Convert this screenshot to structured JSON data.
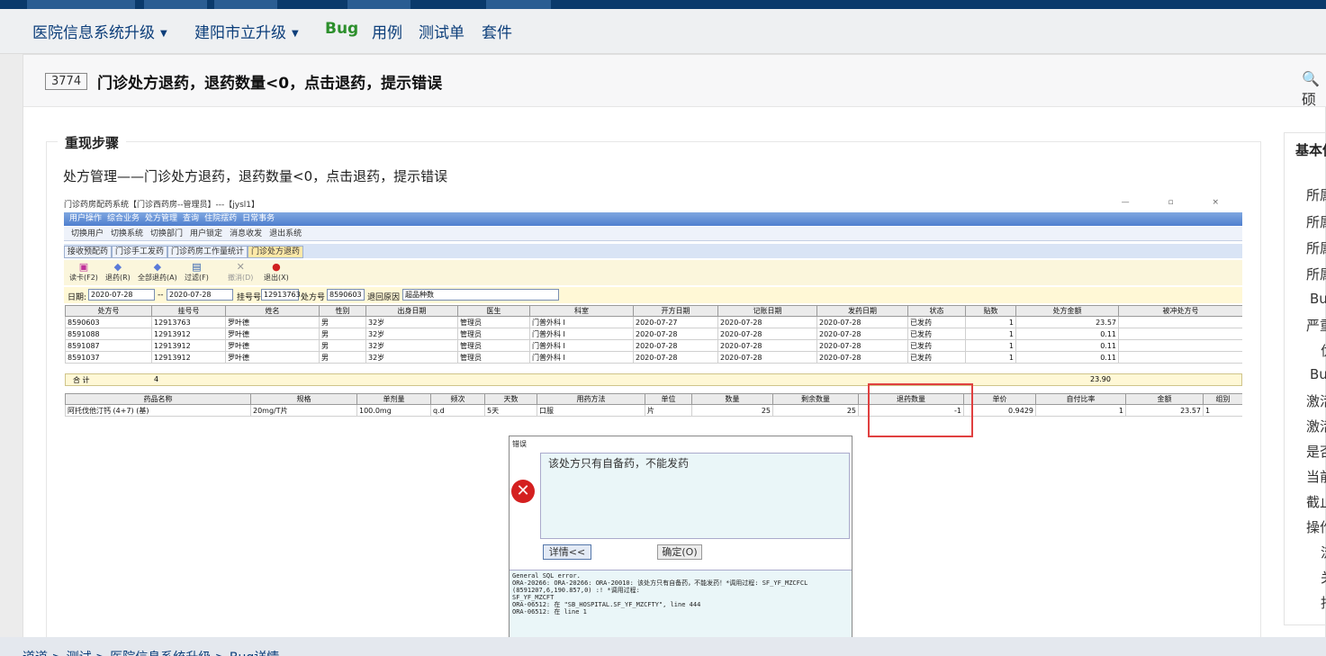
{
  "nav": {
    "product_menu": "医院信息系统升级",
    "project_menu": "建阳市立升级",
    "tabs": [
      "Bug",
      "用例",
      "测试单",
      "套件"
    ]
  },
  "bug": {
    "id": "3774",
    "title": "门诊处方退药，退药数量<0，点击退药，提示错误"
  },
  "search_label": "硕",
  "steps": {
    "legend": "重现步骤",
    "text": "处方管理——门诊处方退药，退药数量<0，点击退药，提示错误"
  },
  "sidebar": {
    "title": "基本信息",
    "rows": [
      "所属",
      "所属",
      "所属",
      "所属",
      "Bu",
      "严重",
      "优",
      "Bu",
      "激活",
      "激活",
      "是否",
      "当前",
      "截止",
      "操作",
      "流",
      "关",
      "指"
    ]
  },
  "breadcrumb": "道道  >  测试  >  医院信息系统升级  >  Bug详情",
  "screenshot": {
    "window_title": "门诊药房配药系统【门诊西药房--管理员】---【jysl1】",
    "window_controls": "— ▫ ×",
    "menus": [
      "用户操作",
      "综合业务",
      "处方管理",
      "查询",
      "住院摆药",
      "日常事务"
    ],
    "toolbar": [
      "切换用户",
      "切换系统",
      "切换部门",
      "用户锁定",
      "消息收发",
      "退出系统"
    ],
    "tabs": [
      "接收预配药",
      "门诊手工发药",
      "门诊药房工作量统计",
      "门诊处方退药"
    ],
    "actions": [
      {
        "icon": "▣",
        "label": "读卡(F2)"
      },
      {
        "icon": "◆",
        "label": "退药(R)"
      },
      {
        "icon": "◆",
        "label": "全部退药(A)"
      },
      {
        "icon": "▤",
        "label": "过滤(F)"
      },
      {
        "icon": "✕",
        "label": "撤消(D)"
      },
      {
        "icon": "●",
        "label": "退出(X)"
      }
    ],
    "filters": {
      "date_label": "日期:",
      "date_from": "2020-07-28",
      "sep": "--",
      "date_to": "2020-07-28",
      "reg_label": "挂号号",
      "reg_value": "12913763",
      "rx_label": "处方号",
      "rx_value": "8590603",
      "reason_label": "退回原因",
      "reason_value": "超品种数"
    },
    "grid1": {
      "columns": [
        "处方号",
        "挂号号",
        "姓名",
        "性别",
        "出身日期",
        "医生",
        "科室",
        "开方日期",
        "记账日期",
        "发药日期",
        "状态",
        "贴数",
        "处方金额",
        "被冲处方号"
      ],
      "rows": [
        [
          "8590603",
          "12913763",
          "罗叶德",
          "男",
          "32岁",
          "管理员",
          "门普外科 I",
          "2020-07-27",
          "2020-07-28",
          "2020-07-28",
          "已发药",
          "1",
          "23.57",
          ""
        ],
        [
          "8591088",
          "12913912",
          "罗叶德",
          "男",
          "32岁",
          "管理员",
          "门普外科 I",
          "2020-07-28",
          "2020-07-28",
          "2020-07-28",
          "已发药",
          "1",
          "0.11",
          ""
        ],
        [
          "8591087",
          "12913912",
          "罗叶德",
          "男",
          "32岁",
          "管理员",
          "门普外科 I",
          "2020-07-28",
          "2020-07-28",
          "2020-07-28",
          "已发药",
          "1",
          "0.11",
          ""
        ],
        [
          "8591037",
          "12913912",
          "罗叶德",
          "男",
          "32岁",
          "管理员",
          "门普外科 I",
          "2020-07-28",
          "2020-07-28",
          "2020-07-28",
          "已发药",
          "1",
          "0.11",
          ""
        ]
      ],
      "total_label": "合  计",
      "total_count": "4",
      "total_amount": "23.90"
    },
    "grid2": {
      "columns": [
        "药品名称",
        "规格",
        "单剂量",
        "频次",
        "天数",
        "用药方法",
        "单位",
        "数量",
        "剩余数量",
        "退药数量",
        "单价",
        "自付比率",
        "金额",
        "组别"
      ],
      "rows": [
        [
          "阿托伐他汀钙 (4+7) (基)",
          "20mg/T片",
          "100.0mg",
          "q.d",
          "5天",
          "口服",
          "片",
          "25",
          "25",
          "-1",
          "0.9429",
          "1",
          "23.57",
          "1"
        ]
      ]
    },
    "error": {
      "title": "错误",
      "message": "该处方只有自备药，不能发药",
      "details_button": "详情<<",
      "ok_button": "确定(O)",
      "log": "General SQL error.\nORA-20266: ORA-20266: ORA-20010: 该处方只有自备药，不能发药！*调用过程: SF_YF_MZCFCL\n(8591207,6,190.857,0) :! *调用过程:\nSF_YF_MZCFT\nORA-06512: 在 \"SB_HOSPITAL.SF_YF_MZCFTY\", line 444\nORA-06512: 在 line 1"
    }
  }
}
